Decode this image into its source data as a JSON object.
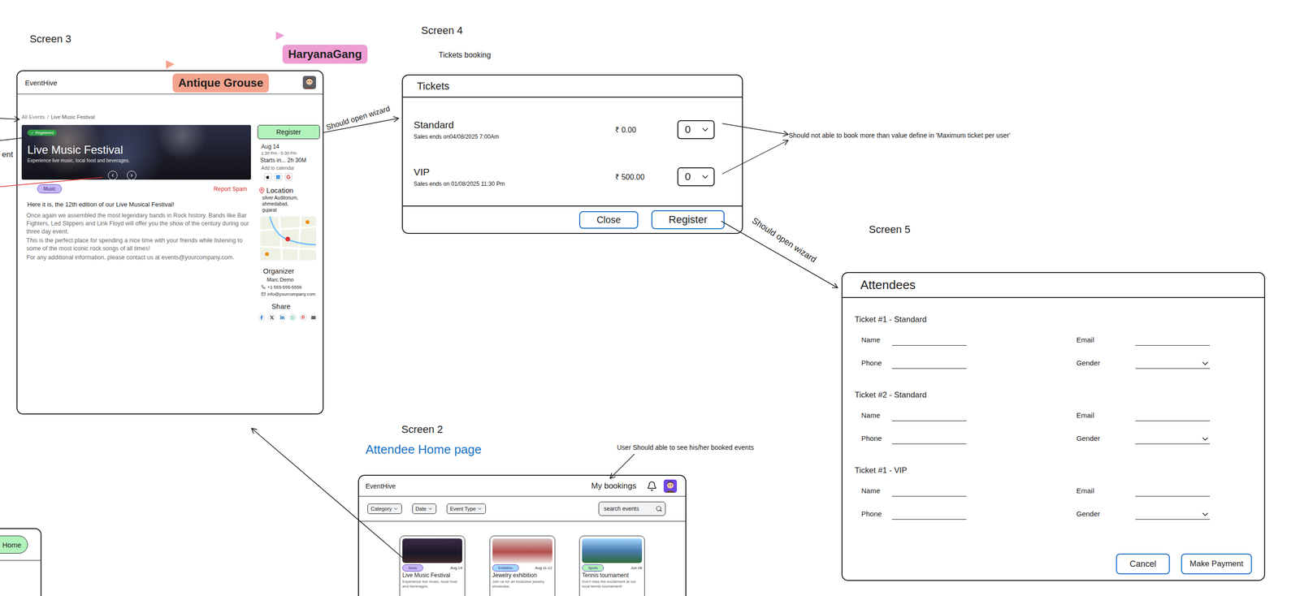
{
  "canvas_labels": {
    "screen3": "Screen 3",
    "screen4": "Screen 4",
    "screen5": "Screen 5",
    "screen2": "Screen 2",
    "screen4_caption": "Tickets booking",
    "screen2_caption": "Attendee Home page"
  },
  "cursors": [
    {
      "label": "Antique Grouse",
      "color": "#f4a48e"
    },
    {
      "label": "HaryanaGang",
      "color": "#ee9dd2"
    }
  ],
  "annotations": {
    "open_wizard_1": "Should open wizard",
    "open_wizard_2": "Should open wizard",
    "max_tickets": "Should not able to book more than value define in 'Maximum ticket per user'",
    "bookings": "User Should able to see his/her booked events",
    "cut_text": "ent"
  },
  "home_fragment": {
    "button": "Home"
  },
  "event_page": {
    "logo": "EventHive",
    "breadcrumb": [
      {
        "label": "All Events",
        "selected": false
      },
      {
        "label": "Live Music Festival",
        "selected": true
      }
    ],
    "breadcrumb_separator": "/",
    "banner": {
      "badge": "Registered",
      "title": "Live Music Festival",
      "subtitle": "Experience live music, local food and beverages.",
      "prev": "‹",
      "next": "›"
    },
    "tag": "Music",
    "report": "Report Spam",
    "intro": "Here it is, the 12th edition of our Live Musical Festival!",
    "paragraphs": [
      "Once again we assembled the most legendary bands in Rock history. Bands like Bar Fighters, Led Slippers and Link Floyd will offer you the show of the century during our three day event.",
      "This is the perfect place for spending a nice time with your friends while listening to some of the most iconic rock songs of all times!",
      "For any additional information, please contact us at events@yourcompany.com."
    ],
    "register": "Register",
    "date": "Aug 14",
    "time": "1:30 Pm - 5:30 Pm",
    "countdown": "Starts in... 2h 30M",
    "calendar": "Add to calendar",
    "location": {
      "title": "Location",
      "lines": [
        "silver Auditorium,",
        "ahmedabad,",
        "gujarat"
      ]
    },
    "organizer": {
      "title": "Organizer",
      "name": "Marc Demo",
      "phone": "+1 555-555-5556",
      "email": "info@yourcompany.com"
    },
    "share": "Share"
  },
  "tickets": {
    "title": "Tickets",
    "rows": [
      {
        "name": "Standard",
        "sales": "Sales ends on04/08/2025 7:00Am",
        "price": "₹ 0.00",
        "qty": "0"
      },
      {
        "name": "VIP",
        "sales": "Sales ends on 01/08/2025 11:30 Pm",
        "price": "₹ 500.00",
        "qty": "0"
      }
    ],
    "buttons": [
      "Close",
      "Register"
    ]
  },
  "attendees": {
    "title": "Attendees",
    "groups": [
      {
        "title": "Ticket #1 - Standard",
        "fields": [
          {
            "label": "Name",
            "kind": "text"
          },
          {
            "label": "Email",
            "kind": "text"
          },
          {
            "label": "Phone",
            "kind": "text"
          },
          {
            "label": "Gender",
            "kind": "select"
          }
        ]
      },
      {
        "title": "Ticket #2 - Standard",
        "fields": [
          {
            "label": "Name",
            "kind": "text"
          },
          {
            "label": "Email",
            "kind": "text"
          },
          {
            "label": "Phone",
            "kind": "text"
          },
          {
            "label": "Gender",
            "kind": "select"
          }
        ]
      },
      {
        "title": "Ticket #1 - VIP",
        "fields": [
          {
            "label": "Name",
            "kind": "text"
          },
          {
            "label": "Email",
            "kind": "text"
          },
          {
            "label": "Phone",
            "kind": "text"
          },
          {
            "label": "Gender",
            "kind": "select"
          }
        ]
      }
    ],
    "buttons": [
      "Cancel",
      "Make Payment"
    ]
  },
  "home": {
    "logo": "EventHive",
    "bookings": "My bookings",
    "filters": [
      {
        "label": "Category"
      },
      {
        "label": "Date"
      },
      {
        "label": "Event Type"
      }
    ],
    "search": {
      "placeholder": "search events"
    },
    "cards": [
      {
        "title": "Live Music Festival",
        "date": "Aug 14",
        "tag": "Music",
        "color": "#c9b8f5",
        "description": "Experience live music, local food and beverages."
      },
      {
        "title": "Jewelry exhibition",
        "date": "Aug 11-12",
        "tag": "Exhibition",
        "color": "#a5d8ff",
        "description": "Join us for an exclusive jewelry showcase."
      },
      {
        "title": "Tennis tournament",
        "date": "Jun 28",
        "tag": "Sports",
        "color": "#b2f2bb",
        "description": "Don't miss the excitement at our local tennis tournament!"
      }
    ]
  }
}
